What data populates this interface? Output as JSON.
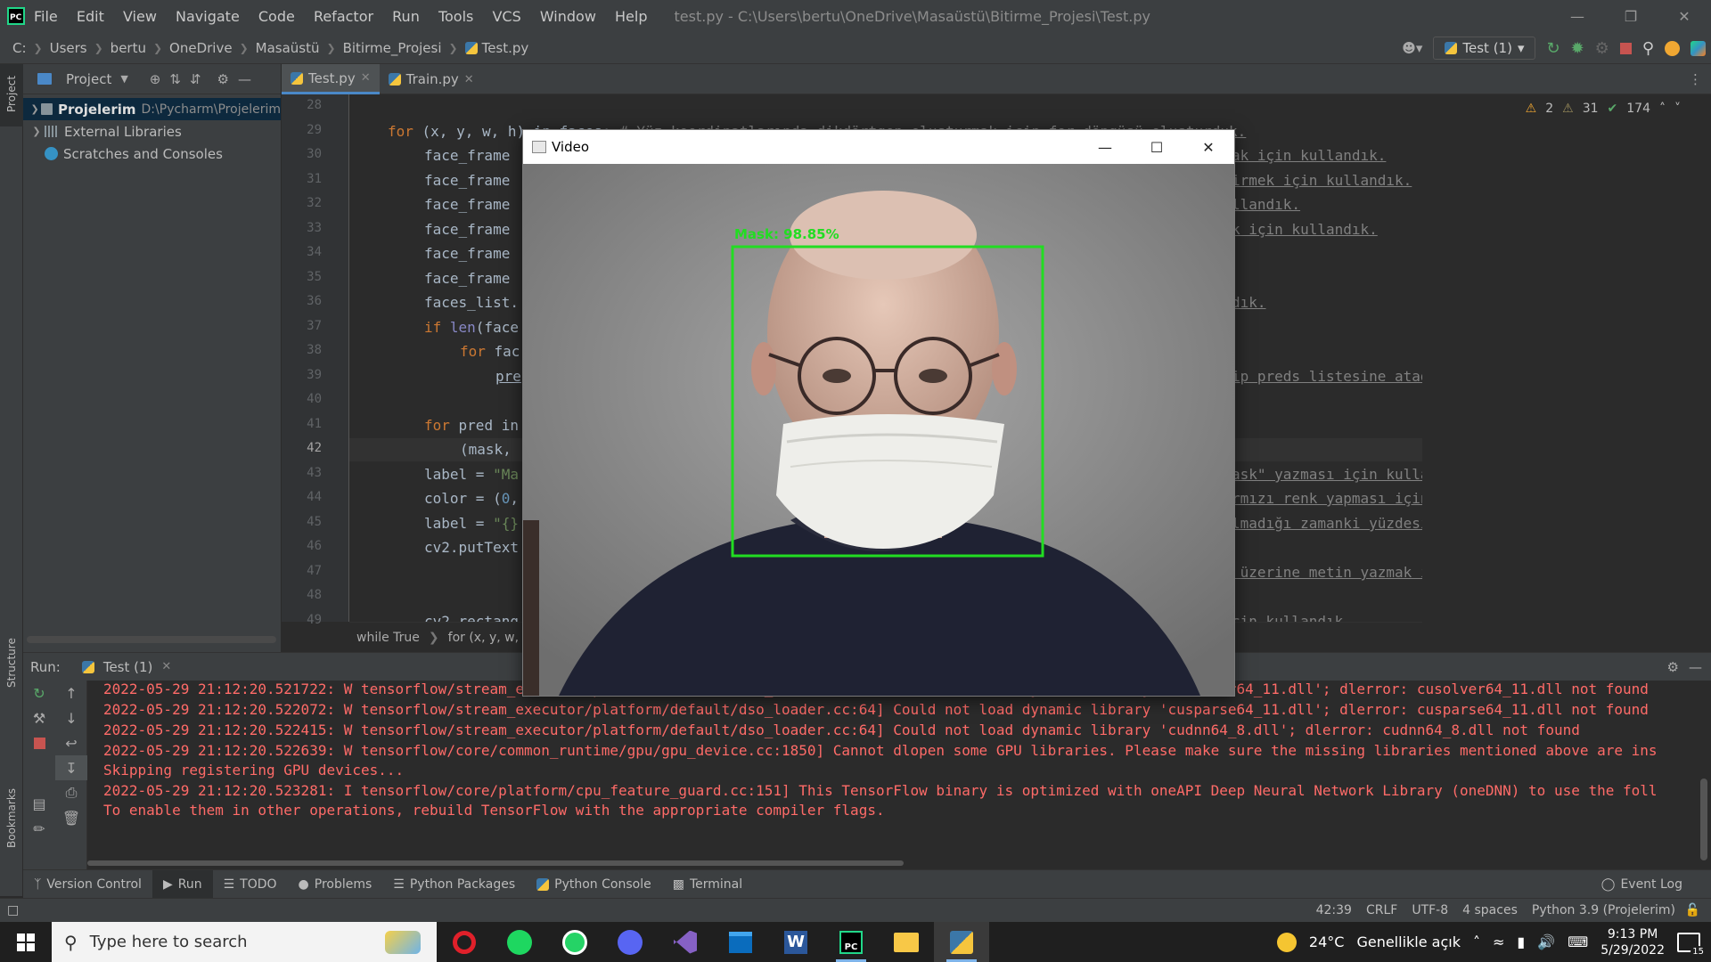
{
  "titlebar": {
    "menu": [
      "File",
      "Edit",
      "View",
      "Navigate",
      "Code",
      "Refactor",
      "Run",
      "Tools",
      "VCS",
      "Window",
      "Help"
    ],
    "window_title": "test.py - C:\\Users\\bertu\\OneDrive\\Masaüstü\\Bitirme_Projesi\\Test.py"
  },
  "navbar": {
    "crumbs": [
      "C:",
      "Users",
      "bertu",
      "OneDrive",
      "Masaüstü",
      "Bitirme_Projesi",
      "Test.py"
    ],
    "run_config": "Test (1)"
  },
  "sidebar": {
    "project_label": "Project",
    "structure_label": "Structure",
    "bookmarks_label": "Bookmarks"
  },
  "project": {
    "title": "Project",
    "items": [
      {
        "label": "Projelerim",
        "path": "D:\\Pycharm\\Projelerim"
      },
      {
        "label": "External Libraries"
      },
      {
        "label": "Scratches and Consoles"
      }
    ]
  },
  "tabs": [
    "Test.py",
    "Train.py"
  ],
  "editor": {
    "warnings": "2",
    "weak_warnings": "31",
    "ok": "174",
    "line_numbers": [
      "28",
      "29",
      "30",
      "31",
      "32",
      "33",
      "34",
      "35",
      "36",
      "37",
      "38",
      "39",
      "40",
      "41",
      "42",
      "43",
      "44",
      "45",
      "46",
      "47",
      "48",
      "49"
    ],
    "breadcrumb": [
      "while True",
      "for (x, y, w, h)"
    ]
  },
  "code": {
    "l29a": "for",
    "l29b": " (x, y, w, h) in faces: ",
    "l29c": "# Yüz koordinatlarında dikdörtgen oluşturmak için for döngüsü oluşturduk.",
    "l30": "face_frame",
    "l30c": "ak için kullandık.",
    "l31": "face_frame",
    "l31c": "irmek için kullandık.",
    "l32": "face_frame",
    "l32c": "llandık.",
    "l33": "face_frame",
    "l33c": "k için kullandık.",
    "l34": "face_frame",
    "l35": "face_frame",
    "l36": "faces_list.",
    "l36c": "dık.",
    "l37a": "if",
    "l37b": " len",
    "l37c": "(face",
    "l38a": "for",
    "l38b": " fac",
    "l39": "pre",
    "l39c": "ip preds listesine atadık.",
    "l41a": "for",
    "l41b": " pred in",
    "l42": "(mask,",
    "l43a": "label = ",
    "l43b": "\"Ma",
    "l43c": "ask\" yazması için kullandık.",
    "l44a": "color = (",
    "l44b": "0",
    "l44c": ",",
    "l44d": "rmızı renk yapması için bu kodu yazdık.",
    "l45a": "label = ",
    "l45b": "\"{}",
    "l45c": "lmadığı zamanki yüzdesini görmek için kullandık.",
    "l46": "cv2.putText",
    "l47c": " üzerine metin yazmak için bu kodu kullandık.",
    "l49": "cv2.rectang",
    "l49c": "cin kullandık."
  },
  "video": {
    "title": "Video",
    "overlay_label": "Mask: 98.85%",
    "box_color": "#22dd22"
  },
  "run": {
    "label": "Run:",
    "tab": "Test (1)",
    "lines": [
      "2022-05-29 21:12:20.521722: W tensorflow/stream_executor/platform/default/dso_loader.cc:64] Could not load dynamic library 'cusolver64_11.dll'; dlerror: cusolver64_11.dll not found",
      "2022-05-29 21:12:20.522072: W tensorflow/stream_executor/platform/default/dso_loader.cc:64] Could not load dynamic library 'cusparse64_11.dll'; dlerror: cusparse64_11.dll not found",
      "2022-05-29 21:12:20.522415: W tensorflow/stream_executor/platform/default/dso_loader.cc:64] Could not load dynamic library 'cudnn64_8.dll'; dlerror: cudnn64_8.dll not found",
      "2022-05-29 21:12:20.522639: W tensorflow/core/common_runtime/gpu/gpu_device.cc:1850] Cannot dlopen some GPU libraries. Please make sure the missing libraries mentioned above are ins",
      "Skipping registering GPU devices...",
      "2022-05-29 21:12:20.523281: I tensorflow/core/platform/cpu_feature_guard.cc:151] This TensorFlow binary is optimized with oneAPI Deep Neural Network Library (oneDNN) to use the foll",
      "To enable them in other operations, rebuild TensorFlow with the appropriate compiler flags."
    ]
  },
  "tooltabs": [
    "Version Control",
    "Run",
    "TODO",
    "Problems",
    "Python Packages",
    "Python Console",
    "Terminal"
  ],
  "event_log": "Event Log",
  "status": {
    "pos": "42:39",
    "eol": "CRLF",
    "enc": "UTF-8",
    "indent": "4 spaces",
    "interp": "Python 3.9 (Projelerim)"
  },
  "taskbar": {
    "search_placeholder": "Type here to search",
    "weather_temp": "24°C",
    "weather_desc": "Genellikle açık",
    "time": "9:13 PM",
    "date": "5/29/2022",
    "notif_count": "15"
  }
}
